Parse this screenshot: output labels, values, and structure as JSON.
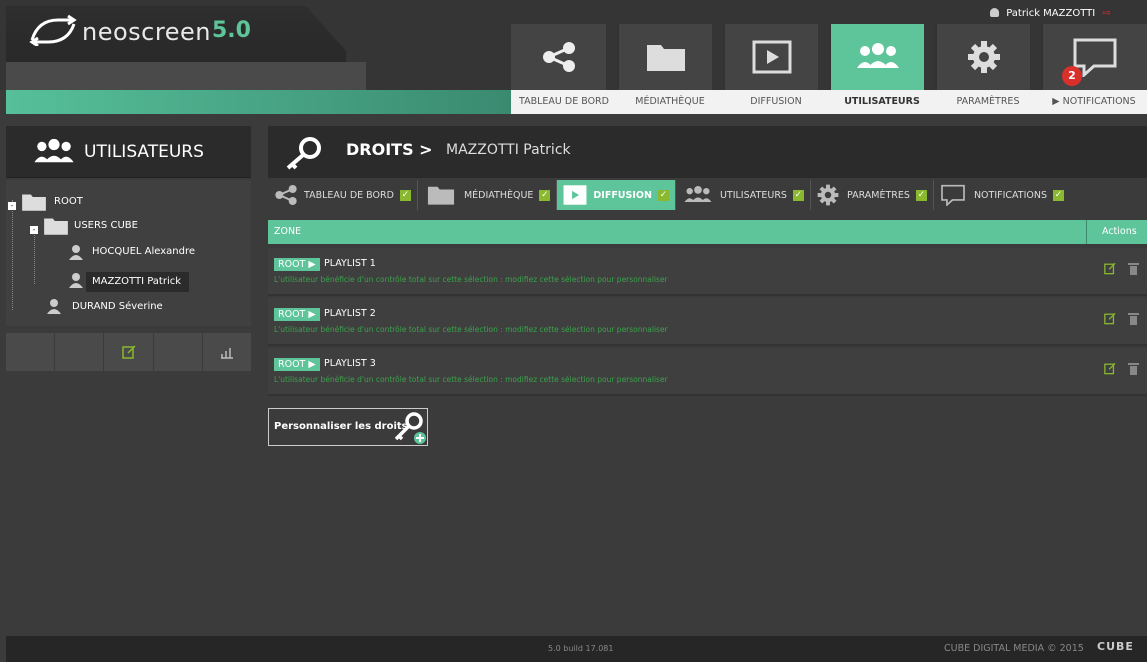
{
  "app": {
    "name": "neoscreen",
    "version": "5.0"
  },
  "user": {
    "name": "Patrick MAZZOTTI"
  },
  "nav": [
    {
      "label": "TABLEAU DE BORD",
      "icon": "share-icon"
    },
    {
      "label": "MÉDIATHÈQUE",
      "icon": "folder-icon"
    },
    {
      "label": "DIFFUSION",
      "icon": "play-icon"
    },
    {
      "label": "UTILISATEURS",
      "icon": "users-icon",
      "active": true
    },
    {
      "label": "PARAMÈTRES",
      "icon": "gear-icon"
    },
    {
      "label": "NOTIFICATIONS",
      "icon": "chat-icon",
      "badge": "2"
    }
  ],
  "left": {
    "title": "UTILISATEURS",
    "tree": [
      {
        "label": "ROOT",
        "type": "folder"
      },
      {
        "label": "USERS CUBE",
        "type": "folder"
      },
      {
        "label": "HOCQUEL Alexandre",
        "type": "user"
      },
      {
        "label": "MAZZOTTI Patrick",
        "type": "user",
        "selected": true
      },
      {
        "label": "DURAND Séverine",
        "type": "user"
      }
    ]
  },
  "rights": {
    "title": "DROITS >",
    "name": "MAZZOTTI Patrick",
    "tabs": [
      {
        "label": "TABLEAU DE BORD"
      },
      {
        "label": "MÉDIATHÈQUE"
      },
      {
        "label": "DIFFUSION",
        "active": true
      },
      {
        "label": "UTILISATEURS"
      },
      {
        "label": "PARAMÈTRES"
      },
      {
        "label": "NOTIFICATIONS"
      }
    ],
    "table": {
      "col_zone": "ZONE",
      "col_actions": "Actions"
    },
    "rows": [
      {
        "root": "ROOT",
        "name": "PLAYLIST 1",
        "msg": "L'utilisateur bénéficie d'un contrôle total sur cette sélection : modifiez cette sélection pour personnaliser"
      },
      {
        "root": "ROOT",
        "name": "PLAYLIST 2",
        "msg": "L'utilisateur bénéficie d'un contrôle total sur cette sélection : modifiez cette sélection pour personnaliser"
      },
      {
        "root": "ROOT",
        "name": "PLAYLIST 3",
        "msg": "L'utilisateur bénéficie d'un contrôle total sur cette sélection : modifiez cette sélection pour personnaliser"
      }
    ],
    "customize": "Personnaliser les droits"
  },
  "footer": {
    "build": "5.0 build 17.081",
    "copyright": "CUBE DIGITAL MEDIA © 2015",
    "brand": "CUBE"
  },
  "colors": {
    "accent": "#5ec49a",
    "dark": "#2b2b2b",
    "alert": "#d9302c",
    "check": "#8ab82e",
    "msg": "#3aa24a"
  }
}
